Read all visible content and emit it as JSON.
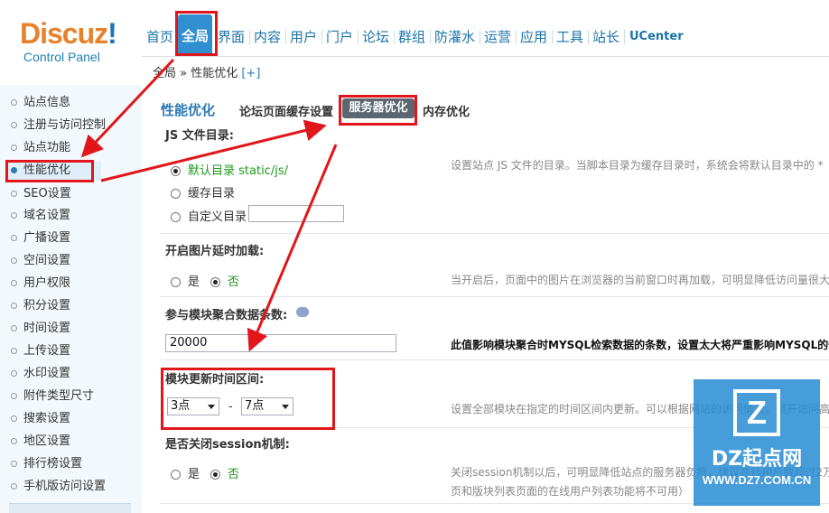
{
  "logo": {
    "text": "Discuz",
    "excl": "!",
    "subtitle": "Control Panel"
  },
  "nav": {
    "items": [
      "首页",
      "全局",
      "界面",
      "内容",
      "用户",
      "门户",
      "论坛",
      "群组",
      "防灌水",
      "运营",
      "应用",
      "工具",
      "站长",
      "UCenter"
    ],
    "active": "全局"
  },
  "breadcrumb": {
    "path": "全局 » 性能优化",
    "add": "[+]"
  },
  "sidebar": {
    "items": [
      "站点信息",
      "注册与访问控制",
      "站点功能",
      "性能优化",
      "SEO设置",
      "域名设置",
      "广播设置",
      "空间设置",
      "用户权限",
      "积分设置",
      "时间设置",
      "上传设置",
      "水印设置",
      "附件类型尺寸",
      "搜索设置",
      "地区设置",
      "排行榜设置",
      "手机版访问设置"
    ],
    "active": "性能优化"
  },
  "main": {
    "title": "性能优化",
    "tabs": [
      "论坛页面缓存设置",
      "服务器优化",
      "内存优化"
    ],
    "active_tab": "服务器优化",
    "js_section": {
      "label": "JS 文件目录:",
      "options": [
        "默认目录 static/js/",
        "缓存目录",
        "自定义目录"
      ],
      "selected": 0,
      "custom_value": "",
      "desc": "设置站点 JS 文件的目录。当脚本目录为缓存目录时，系统会将默认目录中的 *"
    },
    "lazyload": {
      "label": "开启图片延时加载:",
      "yes": "是",
      "no": "否",
      "selected": "no",
      "desc": "当开启后，页面中的图片在浏览器的当前窗口时再加载，可明显降低访问量很大"
    },
    "block_max": {
      "label": "参与模块聚合数据条数:",
      "value": "20000",
      "desc": "此值影响模块聚合时MYSQL检索数据的条数，设置太大将严重影响MYSQL的性"
    },
    "block_time": {
      "label": "模块更新时间区间:",
      "from": "3点",
      "sep": "-",
      "to": "7点",
      "desc": "设置全部模块在指定的时间区间内更新。可以根据网站的访问情况，避开访问高"
    },
    "session": {
      "label": "是否关闭session机制:",
      "yes": "是",
      "no": "否",
      "selected": "no",
      "desc1": "关闭session机制以后，可明显降低站点的服务器负担，建议在线用户数超过2万",
      "desc2": "页和版块列表页面的在线用户列表功能将不可用）"
    }
  },
  "watermark": {
    "letter": "Z",
    "title": "DZ起点网",
    "url": "WWW.DZ7.COM.CN"
  },
  "colors": {
    "accent": "#2d7ab8",
    "highlight": "#e0161b",
    "active_tab": "#5b6670",
    "green": "#1a9a1a"
  }
}
